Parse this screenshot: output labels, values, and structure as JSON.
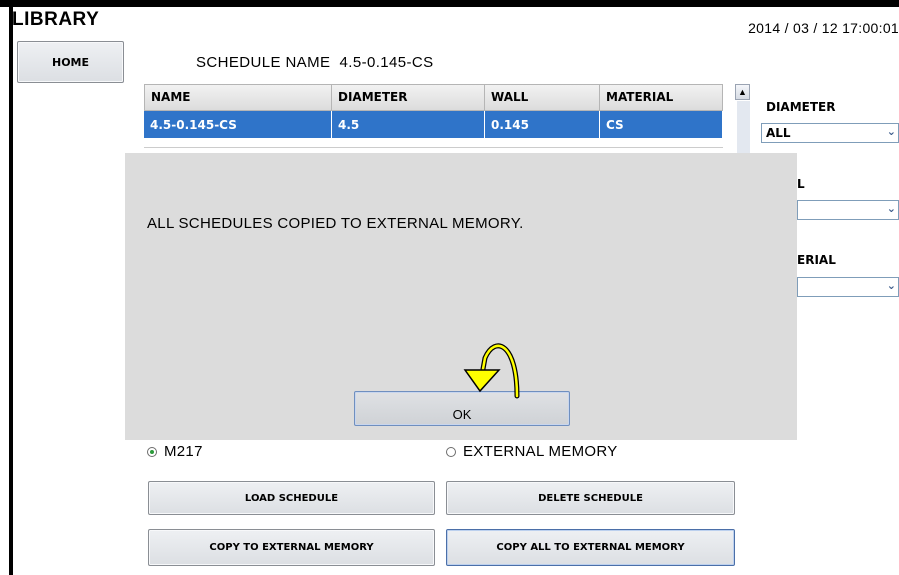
{
  "header": {
    "title": "LIBRARY",
    "datetime": "2014 / 03 / 12   17:00:01"
  },
  "nav": {
    "home_label": "HOME"
  },
  "schedule": {
    "label": "SCHEDULE NAME",
    "value": "4.5-0.145-CS"
  },
  "table": {
    "columns": [
      "NAME",
      "DIAMETER",
      "WALL",
      "MATERIAL"
    ],
    "rows": [
      {
        "name": "4.5-0.145-CS",
        "diameter": "4.5",
        "wall": "0.145",
        "material": "CS",
        "selected": true
      }
    ]
  },
  "filters": {
    "diameter_label": "DIAMETER",
    "diameter_value": "ALL",
    "wall_label_visible": "L",
    "material_label_visible": "ERIAL"
  },
  "dialog": {
    "message": "ALL SCHEDULES COPIED TO EXTERNAL MEMORY.",
    "ok_label": "OK"
  },
  "storage": {
    "option1": "M217",
    "option2": "EXTERNAL MEMORY",
    "selected": "M217"
  },
  "actions": {
    "load": "LOAD SCHEDULE",
    "delete": "DELETE SCHEDULE",
    "copy": "COPY TO EXTERNAL MEMORY",
    "copy_all": "COPY ALL TO EXTERNAL MEMORY"
  },
  "colors": {
    "selection": "#2f74c9",
    "dialog_bg": "#dcdcdc",
    "arrow": "#ffff00"
  }
}
